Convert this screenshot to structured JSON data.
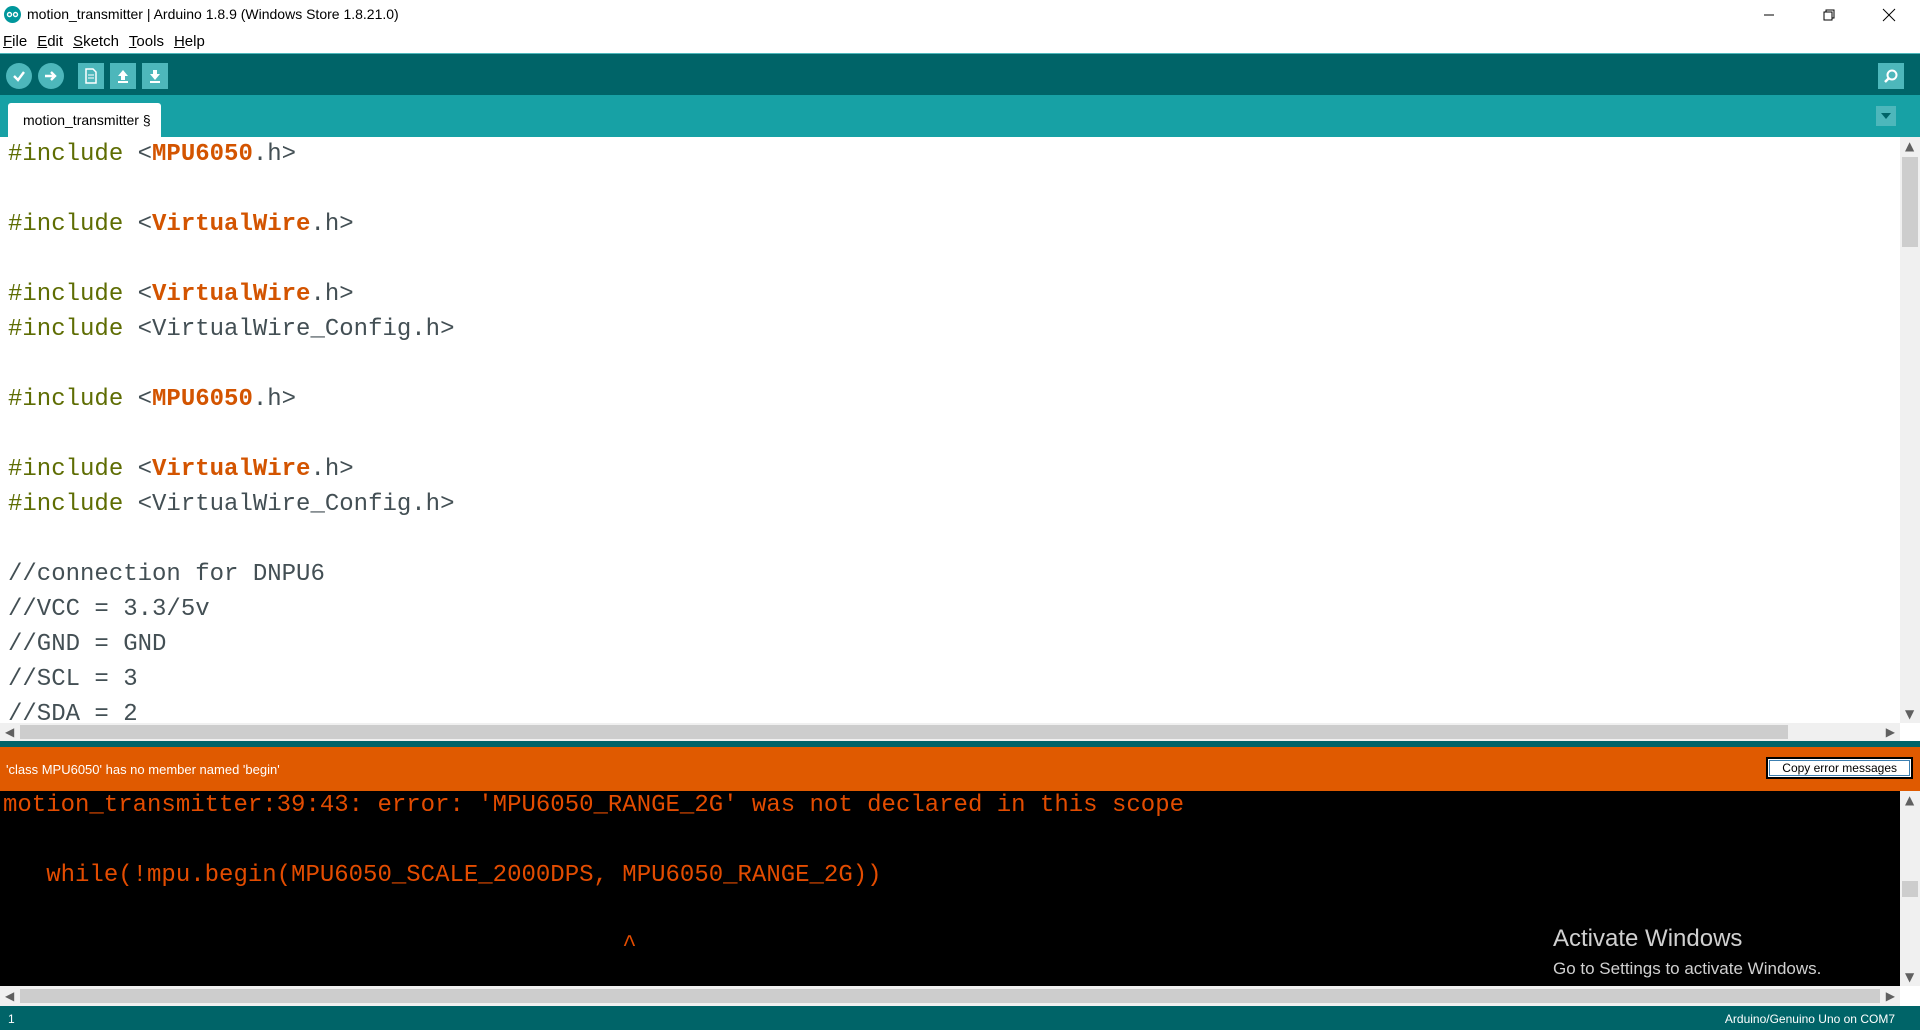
{
  "window": {
    "title": "motion_transmitter | Arduino 1.8.9 (Windows Store 1.8.21.0)"
  },
  "menu": [
    "File",
    "Edit",
    "Sketch",
    "Tools",
    "Help"
  ],
  "toolbar": {
    "icons": [
      "verify-icon",
      "upload-icon",
      "new-icon",
      "open-icon",
      "save-icon",
      "serial-monitor-icon"
    ]
  },
  "tab": {
    "label": "motion_transmitter §"
  },
  "editor": {
    "lines": [
      {
        "prefix": "#include",
        "lt": " <",
        "lib": "MPU6050",
        "rest": ".h>"
      },
      {
        "prefix": "#include",
        "lt": " <",
        "lib": "VirtualWire",
        "rest": ".h>"
      },
      {
        "prefix": "#include",
        "lt": " <",
        "lib": "VirtualWire",
        "rest": ".h>"
      },
      {
        "prefix": "#include",
        "lt": " <",
        "lib": "",
        "rest": "VirtualWire_Config.h>"
      },
      {
        "prefix": "#include",
        "lt": " <",
        "lib": "MPU6050",
        "rest": ".h>"
      },
      {
        "prefix": "#include",
        "lt": " <",
        "lib": "VirtualWire",
        "rest": ".h>"
      },
      {
        "prefix": "#include",
        "lt": " <",
        "lib": "",
        "rest": "VirtualWire_Config.h>"
      },
      {
        "prefix": "",
        "lt": "",
        "lib": "",
        "rest": "//connection for DNPU6"
      },
      {
        "prefix": "",
        "lt": "",
        "lib": "",
        "rest": "//VCC = 3.3/5v"
      },
      {
        "prefix": "",
        "lt": "",
        "lib": "",
        "rest": "//GND = GND"
      },
      {
        "prefix": "",
        "lt": "",
        "lib": "",
        "rest": "//SCL = 3"
      },
      {
        "prefix": "",
        "lt": "",
        "lib": "",
        "rest": "//SDA = 2"
      }
    ]
  },
  "status": {
    "message": "'class MPU6050' has no member named 'begin'",
    "copy_button": "Copy error messages"
  },
  "console": {
    "lines": [
      "motion_transmitter:39:43: error: 'MPU6050_RANGE_2G' was not declared in this scope",
      "   while(!mpu.begin(MPU6050_SCALE_2000DPS, MPU6050_RANGE_2G))",
      "                                           ^"
    ]
  },
  "watermark": {
    "title": "Activate Windows",
    "subtitle": "Go to Settings to activate Windows."
  },
  "footer": {
    "line": "1",
    "board": "Arduino/Genuino Uno on COM7"
  },
  "colors": {
    "toolbar": "#006468",
    "tabs": "#17a1a5",
    "button": "#4db7bb",
    "error_bar": "#e05a00",
    "console_text": "#e34c00",
    "include_keyword": "#5e6d03",
    "library_name": "#d35400"
  }
}
